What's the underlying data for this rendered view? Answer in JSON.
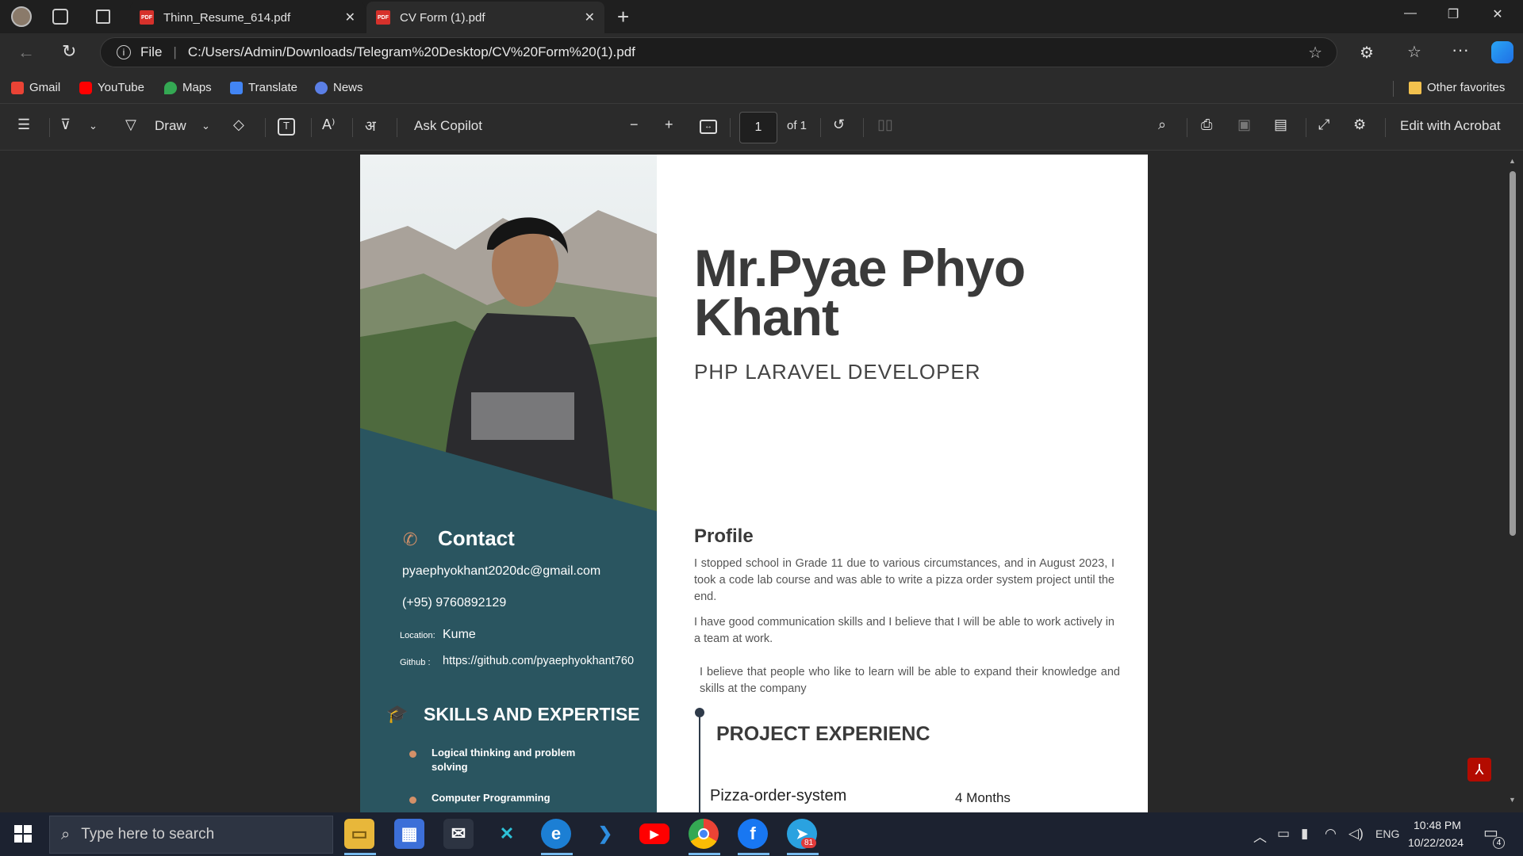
{
  "browser": {
    "tabs": [
      {
        "label": "Thinn_Resume_614.pdf"
      },
      {
        "label": "CV Form (1).pdf"
      }
    ],
    "address": {
      "scheme_label": "File",
      "url": "C:/Users/Admin/Downloads/Telegram%20Desktop/CV%20Form%20(1).pdf"
    },
    "bookmarks": [
      {
        "label": "Gmail"
      },
      {
        "label": "YouTube"
      },
      {
        "label": "Maps"
      },
      {
        "label": "Translate"
      },
      {
        "label": "News"
      }
    ],
    "other_favorites": "Other favorites"
  },
  "pdf_toolbar": {
    "draw_label": "Draw",
    "ask_copilot": "Ask Copilot",
    "page_current": "1",
    "page_total": "of 1",
    "edit_acrobat": "Edit with Acrobat"
  },
  "resume": {
    "name": "Mr.Pyae Phyo Khant",
    "role": "PHP LARAVEL DEVELOPER",
    "contact_title": "Contact",
    "email": "pyaephyokhant2020dc@gmail.com",
    "phone": "(+95) 9760892129",
    "location_label": "Location:",
    "location_value": "Kume",
    "github_label": "Github :",
    "github_value": "https://github.com/pyaephyokhant760",
    "skills_title": "SKILLS AND EXPERTISE",
    "skills": [
      "Logical thinking and problem solving",
      "Computer Programming"
    ],
    "profile_title": "Profile",
    "profile_paragraphs": [
      "I stopped school in Grade 11 due to various circumstances, and in August 2023, I took a code lab course and was able to write a pizza order system project until the end.",
      "I have good communication skills and I believe that I will be able to work actively in a team at work.",
      "I believe that people who like to learn will be able to expand their knowledge and skills at the company"
    ],
    "project_title": "PROJECT EXPERIENC",
    "project_name": "Pizza-order-system",
    "project_duration": "4 Months"
  },
  "taskbar": {
    "search_placeholder": "Type here to search",
    "telegram_badge": "81",
    "language": "ENG",
    "time": "10:48 PM",
    "date": "10/22/2024",
    "notification_count": "4"
  },
  "colors": {
    "sidebar_teal": "#2a5560",
    "accent_orange": "#d39068",
    "name_gray": "#3a3a3a"
  }
}
